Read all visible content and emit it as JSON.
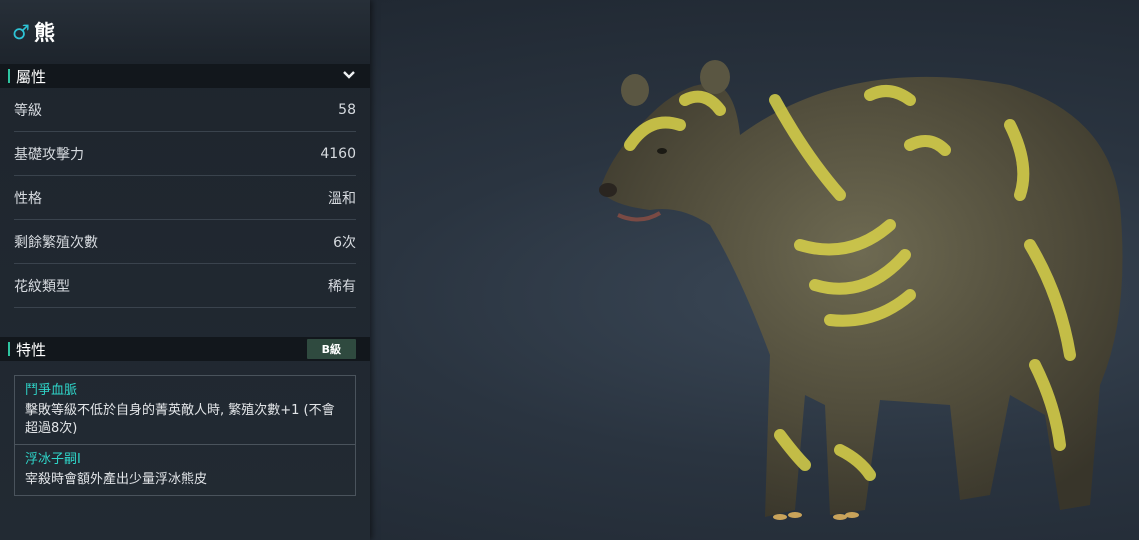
{
  "creature": {
    "gender_symbol": "♂",
    "name": "熊"
  },
  "attributes": {
    "header": "屬性",
    "rows": [
      {
        "label": "等級",
        "value": "58"
      },
      {
        "label": "基礎攻擊力",
        "value": "4160"
      },
      {
        "label": "性格",
        "value": "溫和"
      },
      {
        "label": "剩餘繁殖次數",
        "value": "6次"
      },
      {
        "label": "花紋類型",
        "value": "稀有"
      }
    ]
  },
  "traits": {
    "header": "特性",
    "grade": "B級",
    "items": [
      {
        "name": "鬥爭血脈",
        "desc": "擊敗等級不低於自身的菁英敵人時, 繁殖次數+1 (不會超過8次)"
      },
      {
        "name": "浮冰子嗣I",
        "desc": "宰殺時會額外產出少量浮冰熊皮"
      }
    ]
  },
  "colors": {
    "accent": "#2ec4d6",
    "trait_name": "#2fd4c8",
    "pattern": "#d9d24a"
  },
  "icons": {
    "gender": "male-icon",
    "expand": "chevron-down-icon"
  }
}
